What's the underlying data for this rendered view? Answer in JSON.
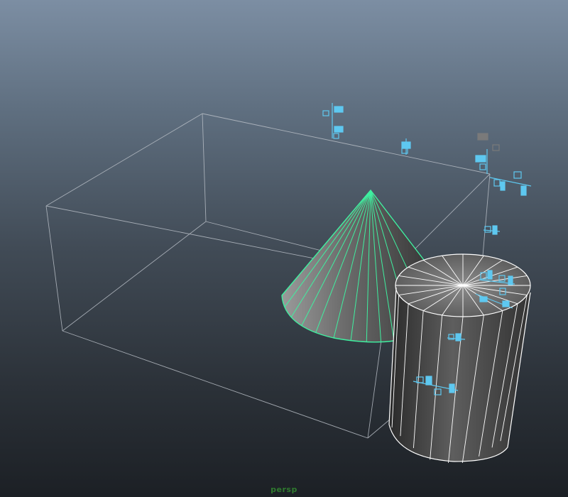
{
  "viewport": {
    "camera_name": "persp"
  },
  "scene": {
    "objects": [
      {
        "name": "cube",
        "display": "wireframe"
      },
      {
        "name": "cone",
        "display": "shaded-wireframe",
        "selected": true
      },
      {
        "name": "cylinder",
        "display": "shaded-wireframe",
        "selected": false
      }
    ],
    "colors": {
      "cube_wire": "#b8bec6",
      "selection_highlight": "#3ff0a0",
      "cylinder_wire": "#ffffff",
      "manipulator": "#5ec8f0",
      "manipulator_inactive": "#7a7a7a"
    }
  }
}
